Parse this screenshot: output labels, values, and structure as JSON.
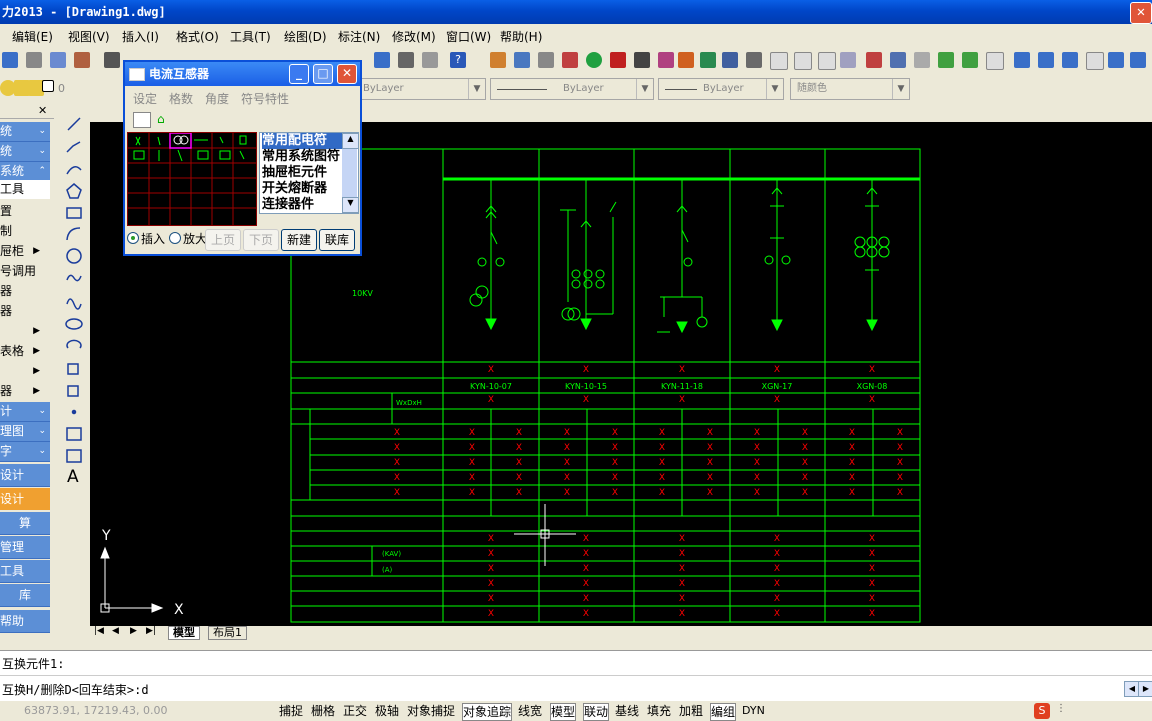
{
  "window": {
    "title": "力2013 - [Drawing1.dwg]"
  },
  "menubar": [
    "编辑(E)",
    "视图(V)",
    "插入(I)",
    "格式(O)",
    "工具(T)",
    "绘图(D)",
    "标注(N)",
    "修改(M)",
    "窗口(W)",
    "帮助(H)"
  ],
  "toolbar2": {
    "layer_value": "0",
    "color_combo": "ByLayer",
    "linetype_combo": "ByLayer",
    "lineweight_combo": "ByLayer",
    "plotstyle_combo": "随颜色"
  },
  "left_panel": {
    "items": [
      {
        "label": "统",
        "style": "blue"
      },
      {
        "label": "统",
        "style": "blue"
      },
      {
        "label": "系统",
        "style": "blue"
      },
      {
        "label": "工具",
        "style": "blue"
      },
      {
        "label": "置",
        "style": "plain"
      },
      {
        "label": "制",
        "style": "plain"
      },
      {
        "label": "屉柜",
        "style": "plain"
      },
      {
        "label": "号调用",
        "style": "plain"
      },
      {
        "label": "器",
        "style": "plain"
      },
      {
        "label": "器",
        "style": "plain"
      },
      {
        "label": "",
        "style": "plain"
      },
      {
        "label": "表格",
        "style": "plain"
      },
      {
        "label": "",
        "style": "plain"
      },
      {
        "label": "器",
        "style": "plain"
      },
      {
        "label": "计",
        "style": "blue"
      },
      {
        "label": "理图",
        "style": "blue"
      },
      {
        "label": "字",
        "style": "blue"
      },
      {
        "label": "设计",
        "style": "blue"
      },
      {
        "label": "设计",
        "style": "orange"
      },
      {
        "label": "算",
        "style": "blue"
      },
      {
        "label": "管理",
        "style": "blue"
      },
      {
        "label": "工具",
        "style": "blue"
      },
      {
        "label": "库",
        "style": "blue"
      },
      {
        "label": "帮助",
        "style": "blue"
      }
    ]
  },
  "dialog": {
    "title": "电流互感器",
    "menu": [
      "设定",
      "格数",
      "角度",
      "符号特性"
    ],
    "list_items": [
      "常用配电符",
      "常用系统图符",
      "抽屉柜元件",
      "开关熔断器",
      "连接器件"
    ],
    "radio_insert": "插入",
    "radio_zoom": "放大",
    "btn_prev": "上页",
    "btn_next": "下页",
    "btn_new": "新建",
    "btn_library": "联库"
  },
  "drawing": {
    "cabinet_models": [
      "KYN-10-07",
      "KYN-10-15",
      "KYN-11-18",
      "XGN-17",
      "XGN-08"
    ],
    "voltage_label": "10KV",
    "dims_label": "WxDxH",
    "kav_label": "(KAV)",
    "a_label": "(A)",
    "x_mark": "X",
    "axis_y": "Y",
    "axis_x": "X"
  },
  "tabs": {
    "model": "模型",
    "layout1": "布局1"
  },
  "command": {
    "line1": "互换元件1:",
    "line2": "互换H/删除D<回车结束>:d"
  },
  "status": {
    "coords": "63873.91, 17219.43, 0.00",
    "buttons": [
      "捕捉",
      "栅格",
      "正交",
      "极轴",
      "对象捕捉",
      "对象追踪",
      "线宽",
      "模型",
      "联动",
      "基线",
      "填充",
      "加粗",
      "编组",
      "DYN"
    ]
  },
  "colors": {
    "cad_green": "#00ff00",
    "cad_red": "#ff0000",
    "canvas_bg": "#000000",
    "xp_blue": "#0a5fe6"
  }
}
